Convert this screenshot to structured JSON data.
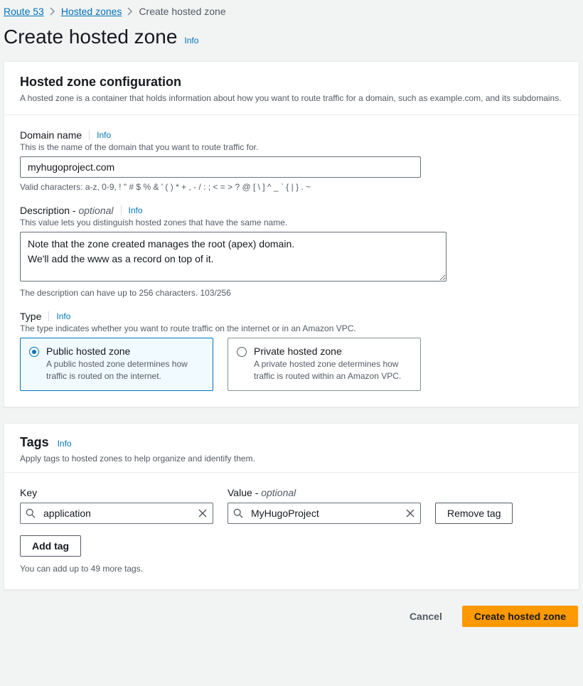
{
  "breadcrumb": {
    "items": [
      {
        "label": "Route 53",
        "link": true
      },
      {
        "label": "Hosted zones",
        "link": true
      },
      {
        "label": "Create hosted zone",
        "link": false
      }
    ]
  },
  "page_title": "Create hosted zone",
  "info_label": "Info",
  "config_panel": {
    "title": "Hosted zone configuration",
    "description": "A hosted zone is a container that holds information about how you want to route traffic for a domain, such as example.com, and its subdomains."
  },
  "domain": {
    "label": "Domain name",
    "help": "This is the name of the domain that you want to route traffic for.",
    "value": "myhugoproject.com",
    "hint": "Valid characters: a-z, 0-9, ! \" # $ % & ' ( ) * + , - / : ; < = > ? @ [ \\ ] ^ _ ` { | } . ~"
  },
  "description": {
    "label_prefix": "Description - ",
    "optional": "optional",
    "help": "This value lets you distinguish hosted zones that have the same name.",
    "value": "Note that the zone created manages the root (apex) domain.\nWe'll add the www as a record on top of it.",
    "hint": "The description can have up to 256 characters. 103/256"
  },
  "type": {
    "label": "Type",
    "help": "The type indicates whether you want to route traffic on the internet or in an Amazon VPC.",
    "options": [
      {
        "title": "Public hosted zone",
        "desc": "A public hosted zone determines how traffic is routed on the internet.",
        "selected": true
      },
      {
        "title": "Private hosted zone",
        "desc": "A private hosted zone determines how traffic is routed within an Amazon VPC.",
        "selected": false
      }
    ]
  },
  "tags": {
    "title": "Tags",
    "desc": "Apply tags to hosted zones to help organize and identify them.",
    "key_label": "Key",
    "value_label_prefix": "Value - ",
    "value_optional": "optional",
    "rows": [
      {
        "key": "application",
        "value": "MyHugoProject"
      }
    ],
    "remove_label": "Remove tag",
    "add_label": "Add tag",
    "limit_hint": "You can add up to 49 more tags."
  },
  "footer": {
    "cancel": "Cancel",
    "create": "Create hosted zone"
  }
}
